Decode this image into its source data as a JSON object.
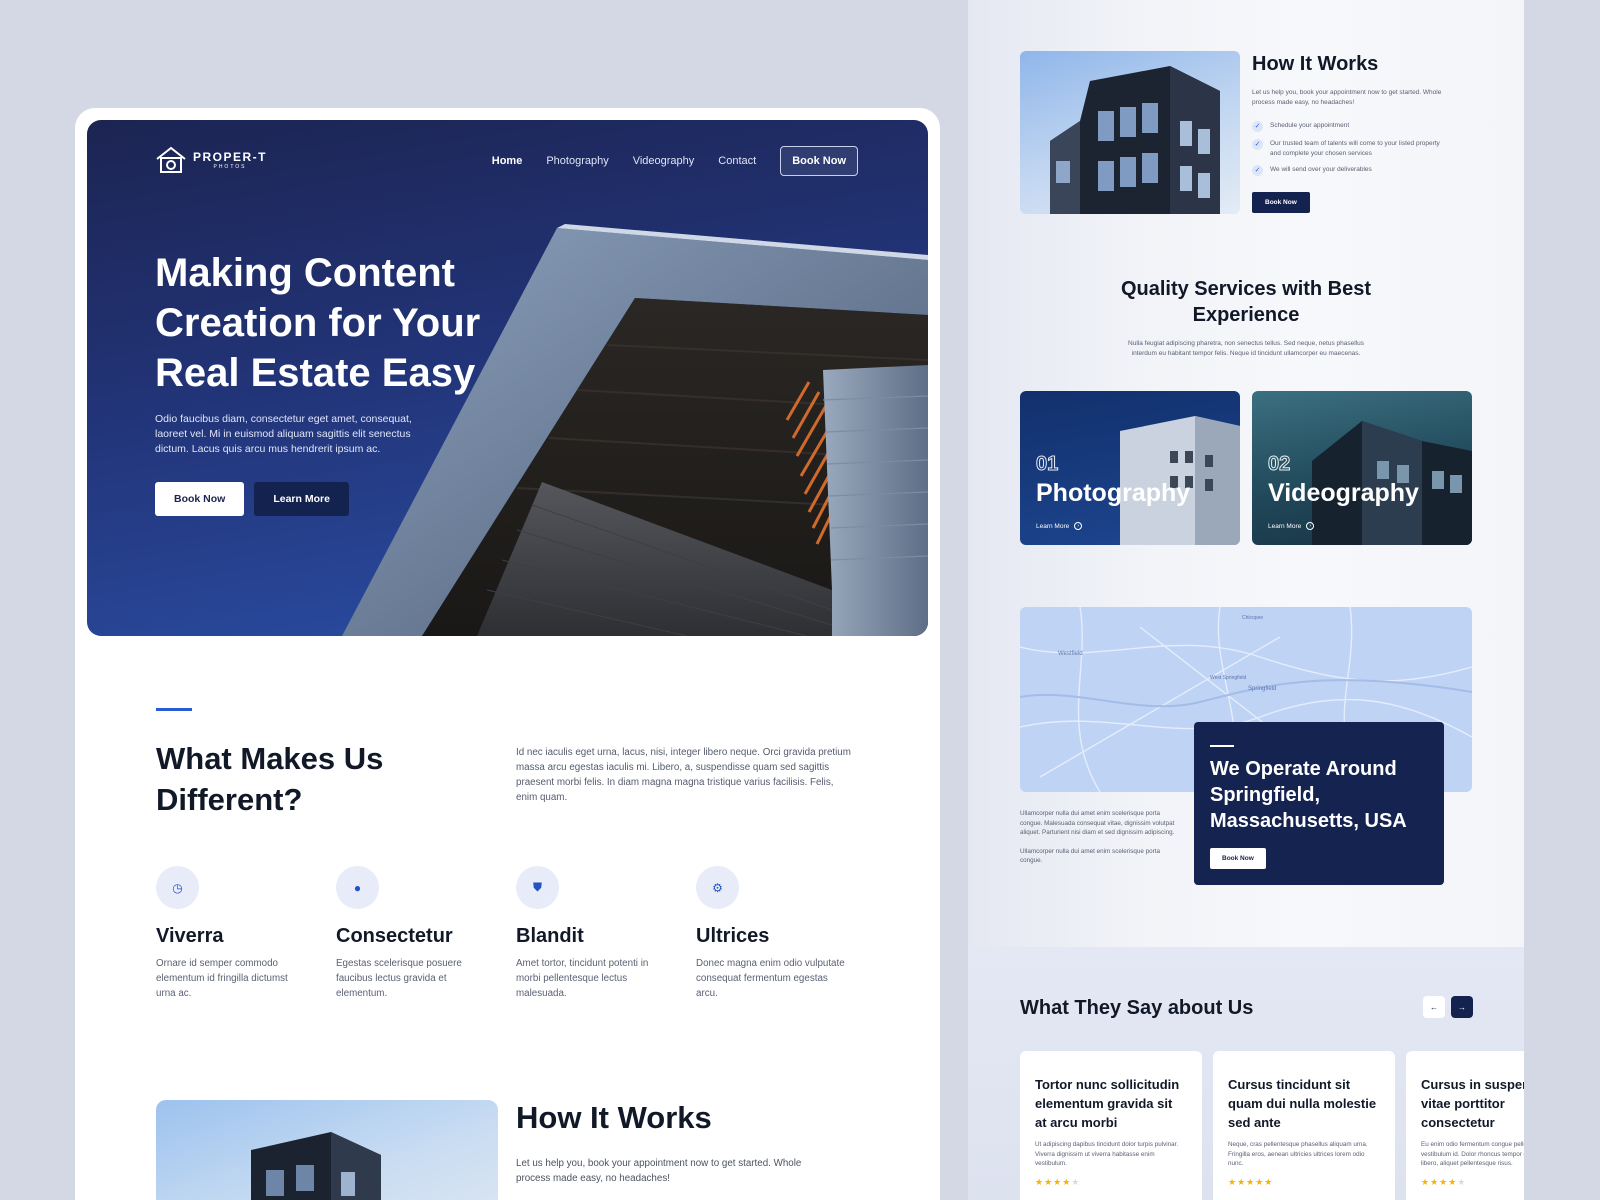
{
  "colors": {
    "navy": "#14224f",
    "accent": "#2a5bd7",
    "bg": "#d3d8e4",
    "star": "#f4b400"
  },
  "hero": {
    "logo": {
      "name": "PROPER-T",
      "sub": "PHOTOS",
      "icon": "house-camera-icon"
    },
    "nav": [
      "Home",
      "Photography",
      "Videography",
      "Contact"
    ],
    "nav_cta": "Book Now",
    "title": "Making Content Creation for Your Real Estate Easy",
    "subtitle": "Odio faucibus diam, consectetur eget amet, consequat, laoreet vel. Mi in euismod aliquam sagittis elit senectus dictum. Lacus quis arcu mus hendrerit ipsum ac.",
    "btn_primary": "Book Now",
    "btn_secondary": "Learn More"
  },
  "different": {
    "title": "What Makes Us Different?",
    "text": "Id nec iaculis eget urna, lacus, nisi, integer libero neque. Orci gravida pretium massa arcu egestas iaculis mi. Libero, a, suspendisse quam sed sagittis praesent morbi felis. In diam magna magna tristique varius facilisis. Felis, enim quam.",
    "features": [
      {
        "title": "Viverra",
        "text": "Ornare id semper commodo elementum id fringilla dictumst urna ac.",
        "icon": "clock-icon"
      },
      {
        "title": "Consectetur",
        "text": "Egestas scelerisque posuere faucibus lectus gravida et elementum.",
        "icon": "chat-icon"
      },
      {
        "title": "Blandit",
        "text": "Amet tortor, tincidunt potenti in morbi pellentesque lectus malesuada.",
        "icon": "shield-icon"
      },
      {
        "title": "Ultrices",
        "text": "Donec magna enim odio vulputate consequat fermentum egestas arcu.",
        "icon": "gear-icon"
      }
    ]
  },
  "how": {
    "title": "How It Works",
    "text": "Let us help you, book your appointment now to get started. Whole process made easy, no headaches!",
    "steps": [
      "Schedule your appointment",
      "Our trusted team of talents will come to your listed property and complete your chosen services",
      "We will send over your deliverables"
    ],
    "btn": "Book Now"
  },
  "services": {
    "title": "Quality Services with Best Experience",
    "text": "Nulla feugiat adipiscing pharetra, non senectus tellus. Sed neque, netus phasellus interdum eu habitant tempor felis. Neque id tincidunt ullamcorper eu maecenas.",
    "items": [
      {
        "num": "01",
        "name": "Photography",
        "link": "Learn More"
      },
      {
        "num": "02",
        "name": "Videography",
        "link": "Learn More"
      }
    ]
  },
  "map": {
    "labels": [
      "Westfield",
      "Springfield",
      "West Springfield",
      "Chicopee"
    ],
    "text1": "Ullamcorper nulla dui amet enim scelerisque porta congue. Malesuada consequat vitae, dignissim volutpat aliquet. Parturient nisi diam et sed dignissim adipiscing.",
    "text2": "Ullamcorper nulla dui amet enim scelerisque porta congue.",
    "card_title": "We Operate Around Springfield, Massachusetts, USA",
    "card_btn": "Book Now"
  },
  "testimonials": {
    "title": "What They Say about Us",
    "prev": "←",
    "next": "→",
    "items": [
      {
        "quote": "Tortor nunc sollicitudin elementum gravida sit at arcu morbi",
        "text": "Ut adipiscing dapibus tincidunt dolor turpis pulvinar. Viverra dignissim ut viverra habitasse enim vestibulum.",
        "rating": 4
      },
      {
        "quote": "Cursus tincidunt sit quam dui nulla molestie sed ante",
        "text": "Neque, cras pellentesque phasellus aliquam urna. Fringilla eros, aenean ultricies ultrices lorem odio nunc.",
        "rating": 5
      },
      {
        "quote": "Cursus in suspendisse vitae porttitor consectetur",
        "text": "Eu enim odio fermentum congue pellentesque vestibulum id. Dolor rhoncus tempor egestas egestas libero, aliquet pellentesque risus.",
        "rating": 4
      }
    ]
  }
}
